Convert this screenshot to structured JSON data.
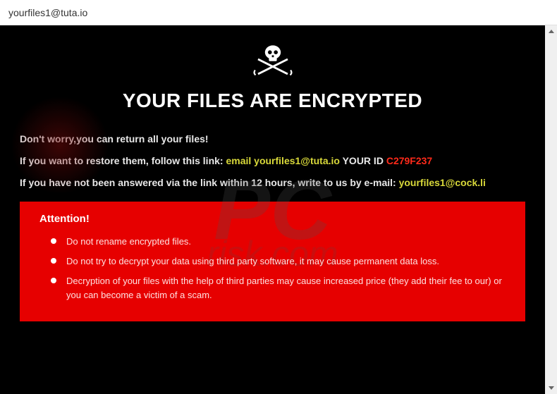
{
  "titlebar": {
    "title": "yourfiles1@tuta.io"
  },
  "skull": {
    "name": "skull-swords-icon"
  },
  "headline": "YOUR FILES ARE ENCRYPTED",
  "lines": {
    "l1": "Don't worry,you can return all your files!",
    "l2a": "If you want to restore them, follow this link: ",
    "l2b": "email yourfiles1@tuta.io",
    "l2c": "  YOUR ID ",
    "l2d": "C279F237",
    "l3a": "If you have not been answered via the link within 12 hours, write to us by e-mail: ",
    "l3b": "yourfiles1@cock.li"
  },
  "attention": {
    "title": "Attention!",
    "items": [
      "Do not rename encrypted files.",
      "Do not try to decrypt your data using third party software, it may cause permanent data loss.",
      "Decryption of your files with the help of third parties may cause increased price (they add their fee to our) or you can become a victim of a scam."
    ]
  },
  "watermark": {
    "big": "PC",
    "sub": "risk.com"
  }
}
